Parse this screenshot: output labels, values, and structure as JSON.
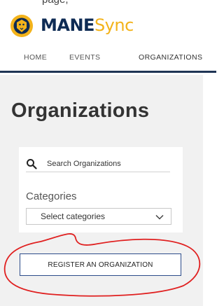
{
  "top_fragment": "page,",
  "brand": {
    "name_bold": "MANE",
    "name_light": "Sync"
  },
  "nav": {
    "tabs": [
      {
        "label": "HOME"
      },
      {
        "label": "EVENTS"
      },
      {
        "label": "ORGANIZATIONS"
      }
    ],
    "active": "ORGANIZATIONS"
  },
  "page": {
    "title": "Organizations"
  },
  "search": {
    "placeholder": "Search Organizations",
    "icon": "search-icon"
  },
  "categories": {
    "label": "Categories",
    "selected": "Select categories",
    "icon": "chevron-down-icon"
  },
  "register": {
    "label": "REGISTER AN ORGANIZATION"
  },
  "colors": {
    "brand_navy": "#0e2b54",
    "brand_gold": "#f3b31b",
    "annotation_red": "#e02020",
    "panel_bg": "#f1f1f1"
  }
}
